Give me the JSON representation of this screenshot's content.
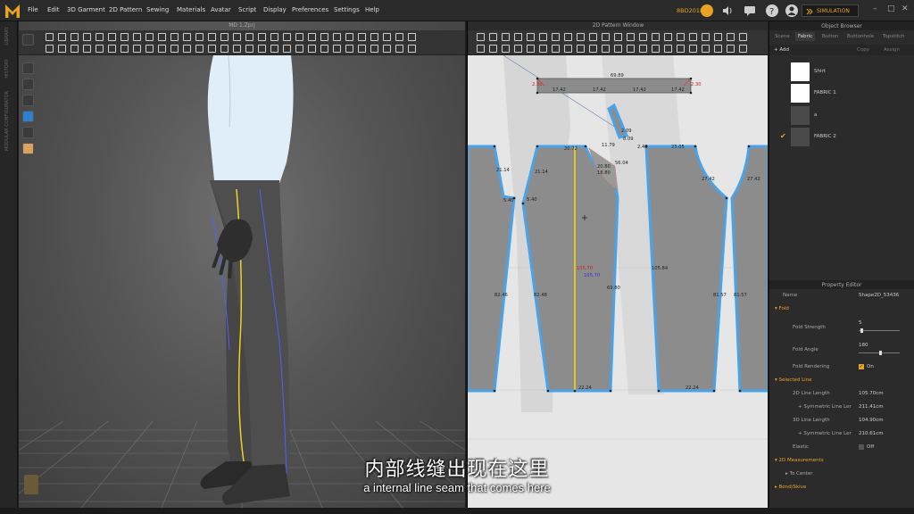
{
  "app": {
    "logo_letter": "M",
    "build": "8BD2018",
    "window_3d": "MD 1.Zprj",
    "window_2d": "2D Pattern Window"
  },
  "menu": [
    "File",
    "Edit",
    "3D Garment",
    "2D Pattern",
    "Sewing",
    "Materials",
    "Avatar",
    "Script",
    "Display",
    "Preferences",
    "Settings",
    "Help"
  ],
  "simulation_label": "SIMULATION",
  "left_rail_labels": [
    "LIBRARY",
    "HISTORY",
    "MODULAR CONFIGURATOR"
  ],
  "object_browser": {
    "title": "Object Browser",
    "tabs": [
      "Scene",
      "Fabric",
      "Button",
      "Buttonhole",
      "Topstitch"
    ],
    "actions": [
      "+ Add",
      "Copy",
      "Assign"
    ],
    "fabrics": [
      {
        "name": "Shirt",
        "color": "#ffffff",
        "checked": false
      },
      {
        "name": "FABRIC 1",
        "color": "#ffffff",
        "checked": false
      },
      {
        "name": "a",
        "color": "#4a4a4a",
        "checked": false
      },
      {
        "name": "FABRIC 2",
        "color": "#4a4a4a",
        "checked": true
      }
    ]
  },
  "property_editor": {
    "title": "Property Editor",
    "name_label": "Name",
    "name_value": "Shape2D_53436",
    "fold_section": "Fold",
    "fold_strength_label": "Fold Strength",
    "fold_strength_value": "5",
    "fold_strength_level": 0.05,
    "fold_angle_label": "Fold Angle",
    "fold_angle_value": "180",
    "fold_angle_level": 0.5,
    "fold_rendering_label": "Fold Rendering",
    "fold_rendering_value": "On",
    "selected_line_section": "Selected Line",
    "line_2d_label": "2D Line Length",
    "line_2d_value": "105.70cm",
    "sym_label_1": "+ Symmetric Line Ler",
    "sym_value_1": "211.41cm",
    "line_3d_label": "3D Line Length",
    "line_3d_value": "104.90cm",
    "sym_label_2": "+ Symmetric Line Ler",
    "sym_value_2": "210.61cm",
    "elastic_label": "Elastic",
    "elastic_value": "Off",
    "measure_section": "2D Measurements",
    "to_center": "To Center",
    "bond_section": "Bond/Skive"
  },
  "pattern_measurements": {
    "waistband_top": "69.89",
    "waistband_parts": [
      "17.42",
      "17.42",
      "17.42",
      "17.42"
    ],
    "waistband_left": "2.30",
    "waistband_right": "2.30",
    "piece1_left": "21.14",
    "piece1_notch": "5.40",
    "piece1_inseam": "82.46",
    "piece2_left": "21.14",
    "piece2_notch": "5.40",
    "piece2_top": "20.72",
    "piece2_side": "11.79",
    "piece2_inseam": "82.48",
    "piece2_outseam": "69.80",
    "piece2_bottom": "22.24",
    "internal_line_red": "105.70",
    "internal_line_blue": "105.70",
    "fly_top": "2.09",
    "fly_mid": "8.09",
    "fly_lower": "20.80",
    "fly_low2": "18.80",
    "fly_side": "56.04",
    "fly_point": "2.48",
    "piece3_top": "23.05",
    "piece3_curve": "27.42",
    "piece3_center": "105.84",
    "piece3_inseam": "81.57",
    "piece3_bottom": "22.24",
    "piece4_curve": "27.42",
    "piece4_inseam": "81.57"
  },
  "subtitles": {
    "chinese": "内部线缝出现在这里",
    "english": "a internal line seam that comes here"
  },
  "colors": {
    "accent": "#e9a322",
    "pattern_outline": "#4aa3e8",
    "internal_line": "#f2d21b",
    "pattern_fill": "#8c8c8c"
  }
}
